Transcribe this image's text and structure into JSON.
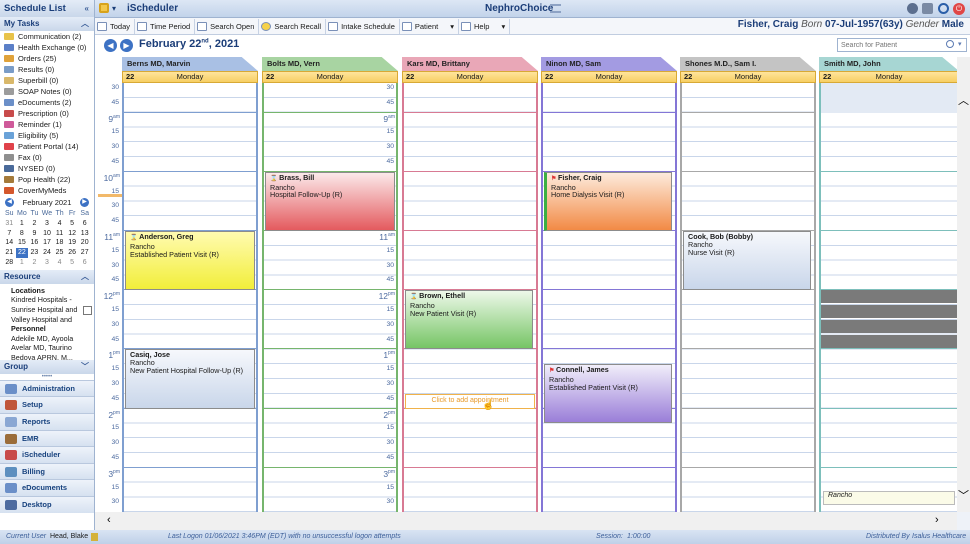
{
  "sidebar": {
    "title": "Schedule List",
    "tasks_header": "My Tasks",
    "tasks": [
      {
        "label": "Communication (2)",
        "icon": "envelope-icon",
        "color": "#e8c34a"
      },
      {
        "label": "Health Exchange (0)",
        "icon": "exchange-icon",
        "color": "#5b7fc7"
      },
      {
        "label": "Orders (25)",
        "icon": "orders-icon",
        "color": "#e0a23a"
      },
      {
        "label": "Results (0)",
        "icon": "results-icon",
        "color": "#7a9cc7"
      },
      {
        "label": "Superbill (0)",
        "icon": "superbill-icon",
        "color": "#d9b86a"
      },
      {
        "label": "SOAP Notes (0)",
        "icon": "soap-icon",
        "color": "#9c9c9c"
      },
      {
        "label": "eDocuments (2)",
        "icon": "edocuments-icon",
        "color": "#6b8fc8"
      },
      {
        "label": "Prescription (0)",
        "icon": "prescription-icon",
        "color": "#c84b4b"
      },
      {
        "label": "Reminder (1)",
        "icon": "reminder-icon",
        "color": "#cf5a9a"
      },
      {
        "label": "Eligibility (5)",
        "icon": "eligibility-icon",
        "color": "#6aa2d8"
      },
      {
        "label": "Patient Portal (14)",
        "icon": "heart-icon",
        "color": "#e0424a"
      },
      {
        "label": "Fax (0)",
        "icon": "fax-icon",
        "color": "#8f8f8f"
      },
      {
        "label": "NYSED (0)",
        "icon": "nysed-icon",
        "color": "#4a6a9a"
      },
      {
        "label": "Pop Health (22)",
        "icon": "pop-health-icon",
        "color": "#a47a3a"
      },
      {
        "label": "CoverMyMeds",
        "icon": "covermymeds-icon",
        "color": "#d4572c"
      }
    ],
    "calendar": {
      "month_label": "February 2021",
      "day_names": [
        "Su",
        "Mo",
        "Tu",
        "We",
        "Th",
        "Fr",
        "Sa"
      ],
      "days": [
        "31",
        "1",
        "2",
        "3",
        "4",
        "5",
        "6",
        "7",
        "8",
        "9",
        "10",
        "11",
        "12",
        "13",
        "14",
        "15",
        "16",
        "17",
        "18",
        "19",
        "20",
        "21",
        "22",
        "23",
        "24",
        "25",
        "26",
        "27",
        "28",
        "1",
        "2",
        "3",
        "4",
        "5",
        "6"
      ],
      "selected": "22"
    },
    "resource_header": "Resource",
    "locations_label": "Locations",
    "locations": [
      "Kindred Hospitals -",
      "Sunrise Hospital and",
      "Valley Hospital and"
    ],
    "personnel_label": "Personnel",
    "personnel": [
      "Adekile MD, Ayoola",
      "Avelar MD, Taurino",
      "Bedoya APRN, M..."
    ],
    "group_header": "Group",
    "nav": [
      {
        "label": "Administration",
        "icon": "administration-icon",
        "color": "#6b8fc8"
      },
      {
        "label": "Setup",
        "icon": "setup-icon",
        "color": "#c0563a"
      },
      {
        "label": "Reports",
        "icon": "reports-icon",
        "color": "#8aa7d3"
      },
      {
        "label": "EMR",
        "icon": "emr-icon",
        "color": "#9b6d3a"
      },
      {
        "label": "iScheduler",
        "icon": "ischeduler-icon",
        "color": "#c84b4b"
      },
      {
        "label": "Billing",
        "icon": "billing-icon",
        "color": "#5d8fbf"
      },
      {
        "label": "eDocuments",
        "icon": "edocuments-nav-icon",
        "color": "#6b8fc8"
      },
      {
        "label": "Desktop",
        "icon": "desktop-icon",
        "color": "#4d6ba0"
      }
    ]
  },
  "header": {
    "module": "iScheduler",
    "app_title": "NephroChoice",
    "toolbar": [
      "Today",
      "Time Period",
      "Search Open",
      "Search Recall",
      "Intake Schedule",
      "Patient",
      "Help"
    ],
    "patient_name": "Fisher, Craig",
    "born_label": "Born",
    "dob": "07-Jul-1957(63y)",
    "gender_label": "Gender",
    "gender": "Male"
  },
  "date": {
    "month_day": "February 22",
    "suffix": "nd",
    "year": ", 2021"
  },
  "search": {
    "placeholder": "Search for Patient"
  },
  "providers": [
    {
      "name": "Berns MD, Marvin",
      "color": "#a9c0e4",
      "border": "#7f9fd0"
    },
    {
      "name": "Bolts MD, Vern",
      "color": "#a8d4a2",
      "border": "#76b56d"
    },
    {
      "name": "Kars MD, Brittany",
      "color": "#e9a7b7",
      "border": "#d87a93"
    },
    {
      "name": "Ninon MD, Sam",
      "color": "#a39be2",
      "border": "#8476d6"
    },
    {
      "name": "Shones M.D., Sam I.",
      "color": "#c4c4c4",
      "border": "#a8a8a8"
    },
    {
      "name": "Smith MD, John",
      "color": "#a7d6d3",
      "border": "#7dbfbb"
    }
  ],
  "day_row": {
    "day": "22",
    "weekday": "Monday"
  },
  "times": [
    {
      "t": "30",
      "hr": false
    },
    {
      "t": "45",
      "hr": false
    },
    {
      "t": "9",
      "hr": true,
      "ap": "am"
    },
    {
      "t": "15",
      "hr": false
    },
    {
      "t": "30",
      "hr": false
    },
    {
      "t": "45",
      "hr": false
    },
    {
      "t": "10",
      "hr": true,
      "ap": "am"
    },
    {
      "t": "15",
      "hr": false
    },
    {
      "t": "30",
      "hr": false
    },
    {
      "t": "45",
      "hr": false
    },
    {
      "t": "11",
      "hr": true,
      "ap": "am"
    },
    {
      "t": "15",
      "hr": false
    },
    {
      "t": "30",
      "hr": false
    },
    {
      "t": "45",
      "hr": false
    },
    {
      "t": "12",
      "hr": true,
      "ap": "pm"
    },
    {
      "t": "15",
      "hr": false
    },
    {
      "t": "30",
      "hr": false
    },
    {
      "t": "45",
      "hr": false
    },
    {
      "t": "1",
      "hr": true,
      "ap": "pm"
    },
    {
      "t": "15",
      "hr": false
    },
    {
      "t": "30",
      "hr": false
    },
    {
      "t": "45",
      "hr": false
    },
    {
      "t": "2",
      "hr": true,
      "ap": "pm"
    },
    {
      "t": "15",
      "hr": false
    },
    {
      "t": "30",
      "hr": false
    },
    {
      "t": "45",
      "hr": false
    },
    {
      "t": "3",
      "hr": true,
      "ap": "pm"
    },
    {
      "t": "15",
      "hr": false
    },
    {
      "t": "30",
      "hr": false
    }
  ],
  "appointments": [
    {
      "col": 0,
      "start": 10,
      "len": 4,
      "name": "Anderson, Greg",
      "loc": "Rancho",
      "type": "Established Patient Visit (R)",
      "bg": "linear-gradient(#fffbb0,#f2ee3a)",
      "icon": "hourglass"
    },
    {
      "col": 0,
      "start": 18,
      "len": 4,
      "name": "Casiq, Jose",
      "loc": "Rancho",
      "type": "New Patient Hospital Follow-Up (R)",
      "bg": "linear-gradient(#f6f8fc,#c9d6ea)",
      "icon": ""
    },
    {
      "col": 1,
      "start": 6,
      "len": 4,
      "name": "Brass, Bill",
      "loc": "Rancho",
      "type": "Hospital Follow-Up (R)",
      "bg": "linear-gradient(#fbe9ea,#e45a5e)",
      "icon": "hourglass"
    },
    {
      "col": 2,
      "start": 14,
      "len": 4,
      "name": "Brown, Ethell",
      "loc": "Rancho",
      "type": "New Patient Visit (R)",
      "bg": "linear-gradient(#edf8e9,#76c565)",
      "icon": "hourglass"
    },
    {
      "col": 3,
      "start": 6,
      "len": 4,
      "name": "Fisher, Craig",
      "loc": "Rancho",
      "type": "Home Dialysis Visit (R)",
      "bg": "linear-gradient(#fdebdc,#f28a45)",
      "icon": "flag"
    },
    {
      "col": 3,
      "start": 19,
      "len": 4,
      "name": "Connell, James",
      "loc": "Rancho",
      "type": "Established Patient Visit (R)",
      "bg": "linear-gradient(#f1eefa,#9a7ed8)",
      "icon": "flag"
    },
    {
      "col": 4,
      "start": 10,
      "len": 4,
      "name": "Cook, Bob (Bobby)",
      "loc": "Rancho",
      "type": "Nurse Visit (R)",
      "bg": "linear-gradient(#f6f8fc,#c9d6ea)",
      "icon": ""
    }
  ],
  "click_hint": "Click to add appointment",
  "smith_partial": "Rancho",
  "status": {
    "current_user_label": "Current User",
    "current_user": "Head, Blake",
    "last_logon": "Last Logon  01/06/2021 3:46PM (EDT)  with no unsuccessful logon attempts",
    "session_label": "Session:",
    "session": "1:00:00",
    "distributed_label": "Distributed By",
    "distributor": "Isalus Healthcare"
  }
}
